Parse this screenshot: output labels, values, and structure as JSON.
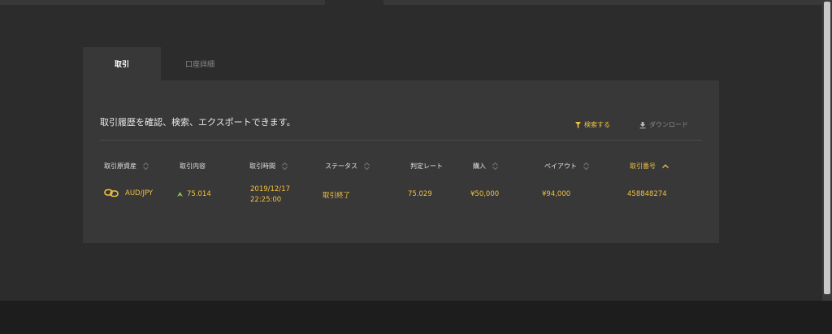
{
  "tabs": [
    {
      "label": "取引"
    },
    {
      "label": "口座詳細"
    }
  ],
  "panel": {
    "description": "取引履歴を確認、検索、エクスポートできます。",
    "search_label": "検索する",
    "download_label": "ダウンロード"
  },
  "table": {
    "headers": [
      "取引原資産",
      "取引内容",
      "取引時間",
      "ステータス",
      "判定レート",
      "購入",
      "ペイアウト",
      "取引番号"
    ],
    "active_sort_column": "取引番号",
    "rows": [
      {
        "asset": "AUD/JPY",
        "content": "75.014",
        "time_date": "2019/12/17",
        "time_clock": "22:25:00",
        "status": "取引終了",
        "rate": "75.029",
        "purchase": "¥50,000",
        "payout": "¥94,000",
        "trade_no": "458848274"
      }
    ]
  },
  "icons": {
    "asset": "link-icon",
    "content": "up-arrow-icon",
    "search": "filter-icon",
    "download": "download-icon"
  },
  "colors": {
    "accent": "#f0c040",
    "up": "#8bc34a",
    "background": "#2c2c2c",
    "panel": "#383838"
  }
}
